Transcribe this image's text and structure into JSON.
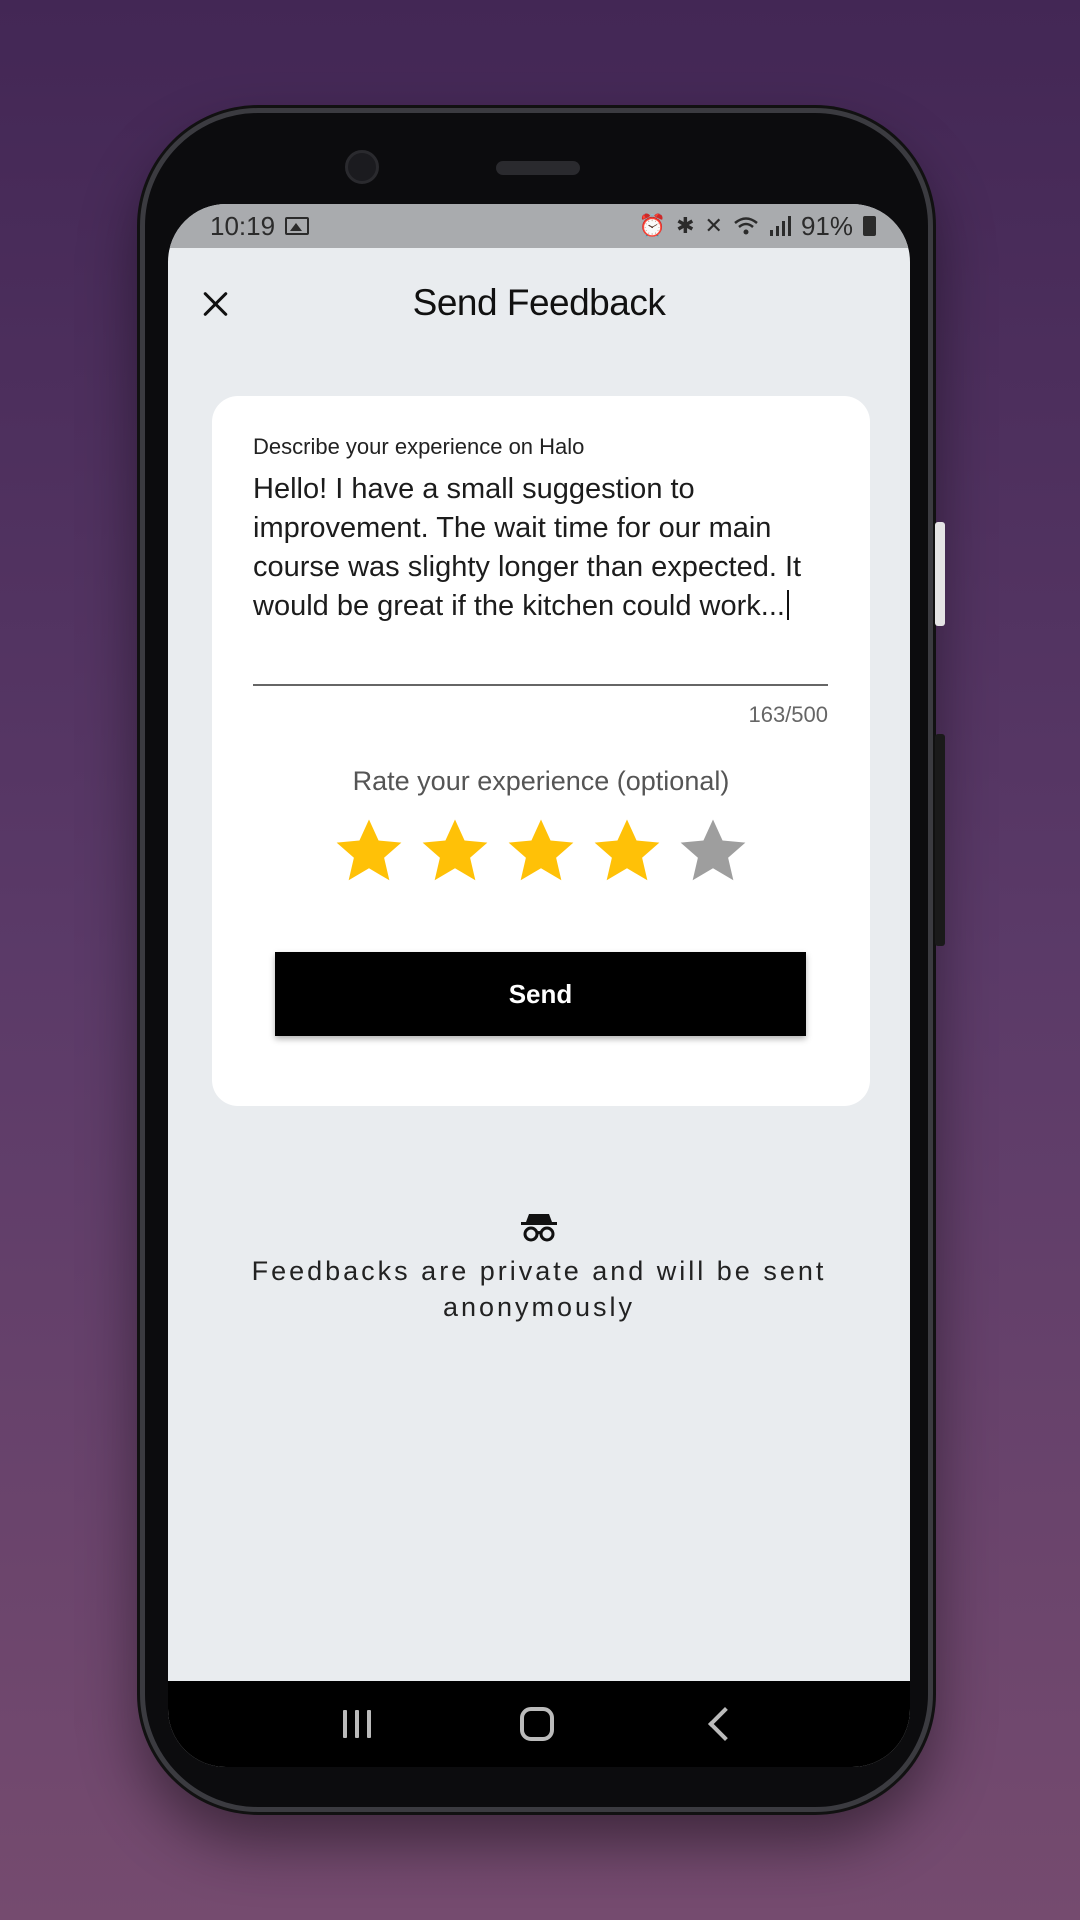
{
  "status_bar": {
    "time": "10:19",
    "battery": "91%",
    "icons": [
      "image-icon",
      "alarm-icon",
      "bluetooth-icon",
      "mute-icon",
      "wifi-icon",
      "signal-icon",
      "battery-icon"
    ]
  },
  "header": {
    "title": "Send Feedback",
    "close_icon": "close-icon"
  },
  "feedback_form": {
    "label": "Describe your experience on Halo",
    "value": "Hello! I have a small suggestion to improvement. The wait time for our main course was slighty longer than expected. It would be great if the kitchen could work...",
    "counter": "163/500"
  },
  "rating": {
    "label": "Rate your experience (optional)",
    "value": 4,
    "max": 5,
    "filled_color": "#FFC107",
    "empty_color": "#9E9E9E"
  },
  "send_button": {
    "label": "Send"
  },
  "privacy": {
    "icon": "incognito-icon",
    "text": "Feedbacks are private and will be sent anonymously"
  },
  "nav_bar": {
    "items": [
      "recent-apps-icon",
      "home-icon",
      "back-icon"
    ]
  }
}
